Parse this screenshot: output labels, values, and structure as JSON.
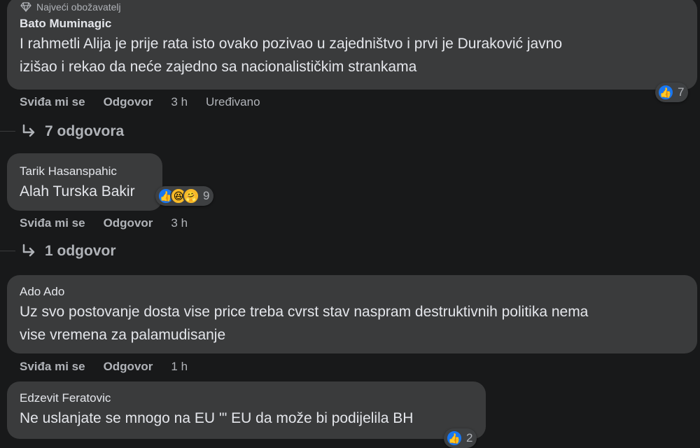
{
  "comments": [
    {
      "badge": "Najveći obožavatelj",
      "author": "Bato Muminagic",
      "text": "I rahmetli Alija je prije rata isto ovako pozivao u zajedništvo i prvi je Duraković javno\nizišao i rekao da neće zajedno sa nacionalističkim strankama",
      "like_label": "Sviđa mi se",
      "reply_label": "Odgovor",
      "time": "3 h",
      "edited": "Uređivano",
      "reaction_count": "7",
      "replies_label": "7 odgovora"
    },
    {
      "author": "Tarik Hasanspahic",
      "text": "Alah Turska Bakir",
      "like_label": "Sviđa mi se",
      "reply_label": "Odgovor",
      "time": "3 h",
      "reaction_count": "9",
      "replies_label": "1 odgovor"
    },
    {
      "author": "Ado Ado",
      "text": "Uz svo postovanje dosta vise price treba cvrst stav naspram destruktivnih politika nema\nvise vremena za palamudisanje",
      "like_label": "Sviđa mi se",
      "reply_label": "Odgovor",
      "time": "1 h"
    },
    {
      "author": "Edzevit Feratovic",
      "text": "Ne uslanjate se mnogo na EU '\" EU da može bi podijelila BH",
      "reaction_count": "2"
    }
  ],
  "icons": {
    "badge": "diamond-icon",
    "reply_arrow": "reply-arrow-icon",
    "like": "like-reaction-icon",
    "haha": "haha-reaction-icon",
    "care": "care-reaction-icon"
  },
  "colors": {
    "background": "#18191a",
    "bubble": "#3a3b3c",
    "text": "#e4e6eb",
    "secondary": "#b0b3b8",
    "like_blue": "#1877f2"
  }
}
